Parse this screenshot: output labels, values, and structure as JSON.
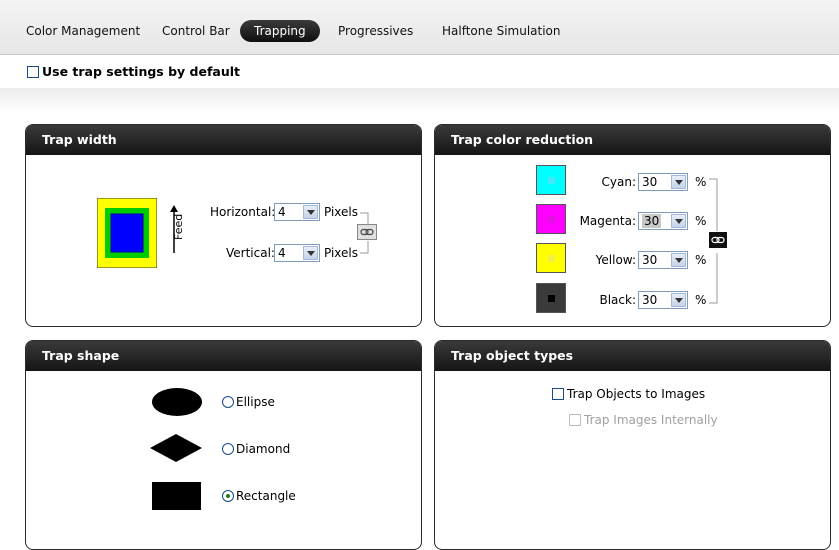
{
  "tabs": [
    {
      "label": "Color Management"
    },
    {
      "label": "Control Bar"
    },
    {
      "label": "Trapping",
      "active": true
    },
    {
      "label": "Progressives"
    },
    {
      "label": "Halftone Simulation"
    }
  ],
  "default_checkbox": {
    "label": "Use trap settings by default",
    "checked": false
  },
  "trap_width": {
    "title": "Trap width",
    "feed_label": "Feed",
    "horizontal": {
      "label": "Horizontal:",
      "value": "4",
      "unit": "Pixels"
    },
    "vertical": {
      "label": "Vertical:",
      "value": "4",
      "unit": "Pixels"
    },
    "linked": true
  },
  "trap_color_reduction": {
    "title": "Trap color reduction",
    "unit": "%",
    "rows": [
      {
        "label": "Cyan:",
        "value": "30",
        "color": "#00ffff"
      },
      {
        "label": "Magenta:",
        "value": "30",
        "color": "#ff00ff"
      },
      {
        "label": "Yellow:",
        "value": "30",
        "color": "#ffff00"
      },
      {
        "label": "Black:",
        "value": "30",
        "color": "#3a3a3a"
      }
    ]
  },
  "trap_shape": {
    "title": "Trap shape",
    "options": [
      {
        "label": "Ellipse",
        "selected": false
      },
      {
        "label": "Diamond",
        "selected": false
      },
      {
        "label": "Rectangle",
        "selected": true
      }
    ]
  },
  "trap_object_types": {
    "title": "Trap object types",
    "objects_to_images": {
      "label": "Trap Objects to Images",
      "checked": false
    },
    "images_internally": {
      "label": "Trap Images Internally",
      "checked": false,
      "disabled": true
    }
  }
}
